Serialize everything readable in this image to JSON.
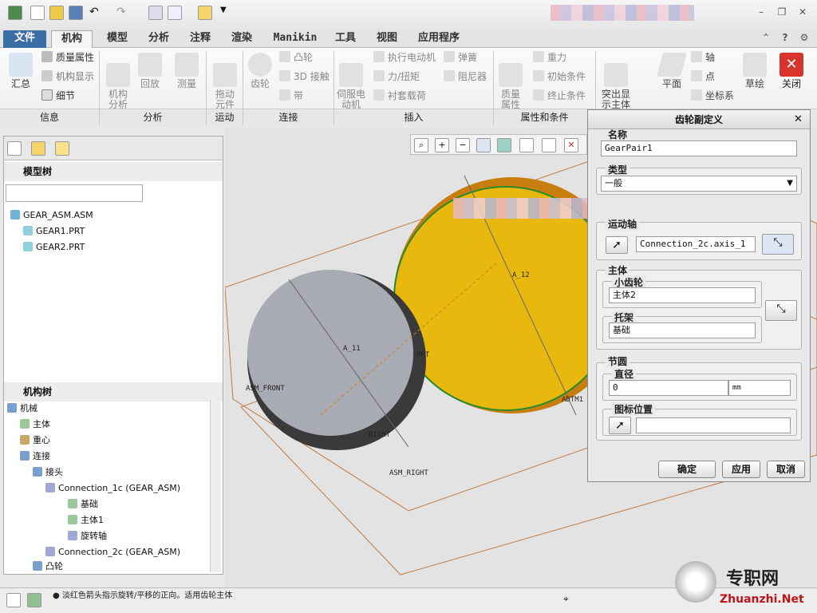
{
  "tabs": [
    "文件",
    "机构",
    "模型",
    "分析",
    "注释",
    "渲染",
    "Manikin",
    "工具",
    "视图",
    "应用程序"
  ],
  "ribbon": {
    "info": {
      "summary": "汇总",
      "mass_props": "质量属性",
      "mech_display": "机构显示",
      "detail": "细节"
    },
    "analysis": {
      "mech_analysis": "机构\n分析",
      "playback": "回放",
      "measure": "测量"
    },
    "motion": {
      "drag": "拖动\n元件"
    },
    "connect": {
      "gear": "齿轮",
      "cam": "凸轮",
      "contact3d": "3D 接触",
      "belt": "带"
    },
    "insert": {
      "servo": "伺服电\n动机",
      "exec_motor": "执行电动机",
      "force_torque": "力/扭矩",
      "bushing": "衬套载荷",
      "spring": "弹簧",
      "damper": "阻尼器"
    },
    "props": {
      "mass": "质量\n属性",
      "gravity": "重力",
      "init_cond": "初始条件",
      "term_cond": "终止条件"
    },
    "misc": {
      "highlight": "突出显\n示主体",
      "plane": "平面",
      "axis": "轴",
      "point": "点",
      "csys": "坐标系",
      "sketch": "草绘",
      "close": "关闭"
    },
    "groups": [
      "信息",
      "分析",
      "运动",
      "连接",
      "插入",
      "属性和条件"
    ]
  },
  "model_tree": {
    "title": "模型树",
    "items": [
      "GEAR_ASM.ASM",
      "GEAR1.PRT",
      "GEAR2.PRT"
    ]
  },
  "mech_tree": {
    "title": "机构树",
    "items": [
      "机械",
      "主体",
      "重心",
      "连接",
      "接头",
      "Connection_1c (GEAR_ASM)",
      "基础",
      "主体1",
      "旋转轴",
      "Connection_2c (GEAR_ASM)",
      "凸轮"
    ]
  },
  "canvas_labels": [
    "ASM_FRONT",
    "ASM_RIGHT",
    "A_11",
    "A_12",
    "PRT",
    "RIGHT",
    "ADTM1"
  ],
  "dialog": {
    "title": "齿轮副定义",
    "name_label": "名称",
    "name_value": "GearPair1",
    "type_label": "类型",
    "type_value": "一般",
    "motion_axis_label": "运动轴",
    "motion_axis_value": "Connection_2c.axis_1",
    "body_label": "主体",
    "pinion_label": "小齿轮",
    "pinion_value": "主体2",
    "carrier_label": "托架",
    "carrier_value": "基础",
    "pitch_label": "节圆",
    "diameter_label": "直径",
    "diameter_value": "0",
    "unit": "mm",
    "icon_pos_label": "图标位置",
    "ok": "确定",
    "apply": "应用",
    "cancel": "取消"
  },
  "status": {
    "message": "● 淡红色箭头指示旋转/平移的正向。适用齿轮主体"
  },
  "watermark": {
    "cn": "专职网",
    "url": "Zhuanzhi.Net"
  },
  "colors": {
    "gear_yellow": "#e8b80f",
    "gear_grey": "#a8aab4",
    "file_tab": "#3b6ea5",
    "close_red": "#d9342b"
  }
}
